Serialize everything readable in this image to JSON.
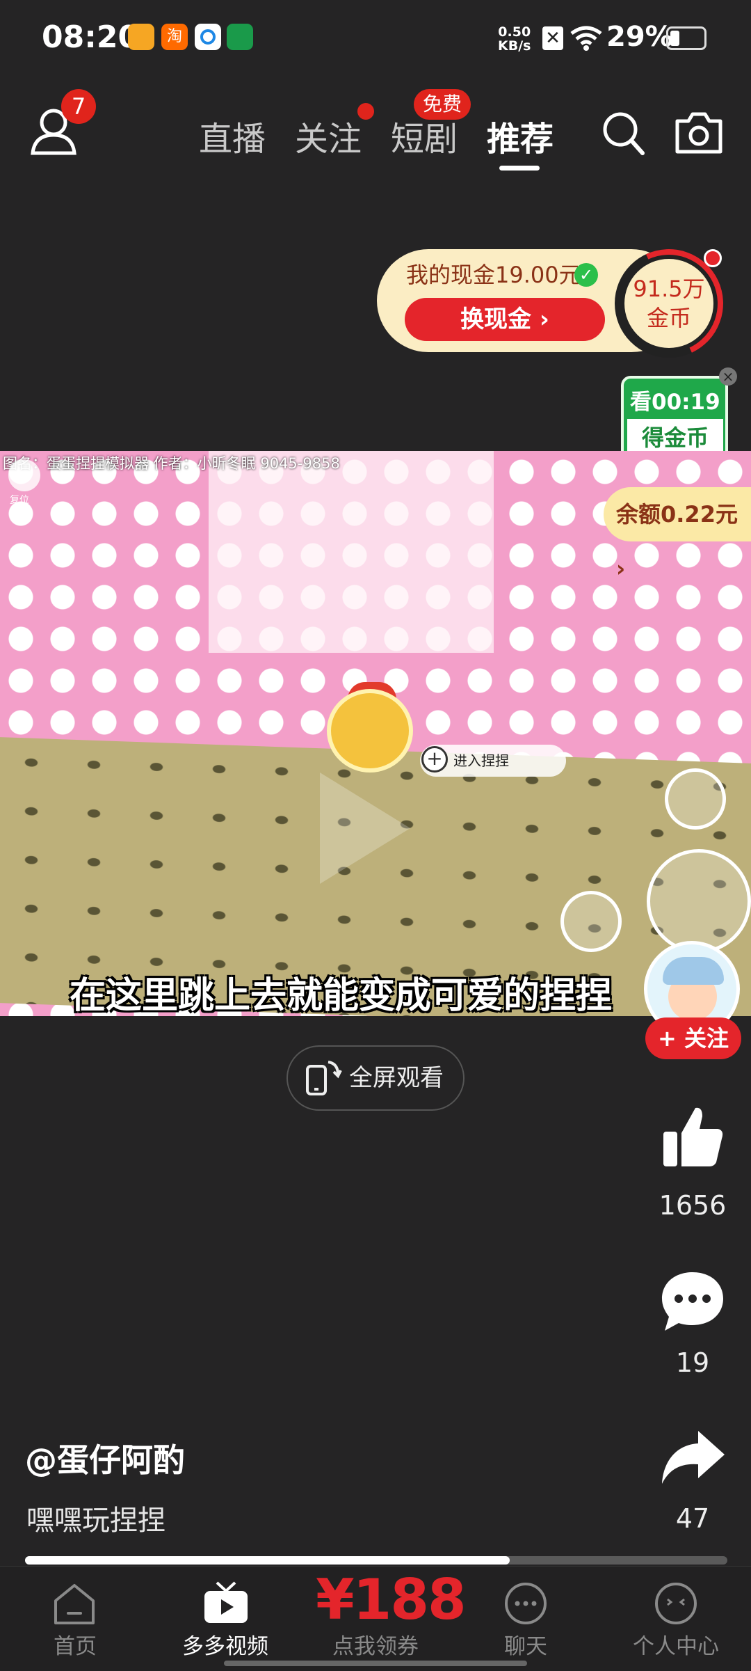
{
  "status_bar": {
    "time": "08:20",
    "net_speed": "0.50",
    "net_unit": "KB/s",
    "battery": "29%",
    "app_icons": [
      "video-app-icon",
      "taobao-icon",
      "browser-icon",
      "post-office-icon"
    ]
  },
  "header": {
    "profile_badge": "7",
    "tabs": [
      {
        "label": "直播",
        "active": false
      },
      {
        "label": "关注",
        "active": false,
        "dot": true
      },
      {
        "label": "短剧",
        "active": false,
        "badge": "免费"
      },
      {
        "label": "推荐",
        "active": true
      }
    ]
  },
  "rewards": {
    "cash_text": "我的现金19.00元",
    "cash_button": "换现金 ›",
    "coins_line1": "91.5万",
    "coins_line2": "金币",
    "watch_timer": "看00:19",
    "watch_reward": "得金币"
  },
  "video": {
    "credit": "图名：蛋蛋捏捏模拟器 作者：小昕冬眠 9045-9858",
    "balance": "余额0.22元 ›",
    "enter_label": "进入捏捏",
    "reset_label": "复位",
    "subtitle": "在这里跳上去就能变成可爱的捏捏",
    "progress": 0.69
  },
  "actions": {
    "follow": "+ 关注",
    "likes": "1656",
    "comments": "19",
    "shares": "47"
  },
  "fullscreen_label": "全屏观看",
  "post": {
    "author": "@蛋仔阿酌",
    "description": "嘿嘿玩捏捏"
  },
  "bottom_nav": {
    "home": "首页",
    "videos": "多多视频",
    "coupon_price": "¥188",
    "coupon_label": "点我领券",
    "chat": "聊天",
    "me": "个人中心"
  },
  "colors": {
    "accent_red": "#e4252b",
    "green": "#1fa84a",
    "background": "#252425"
  }
}
